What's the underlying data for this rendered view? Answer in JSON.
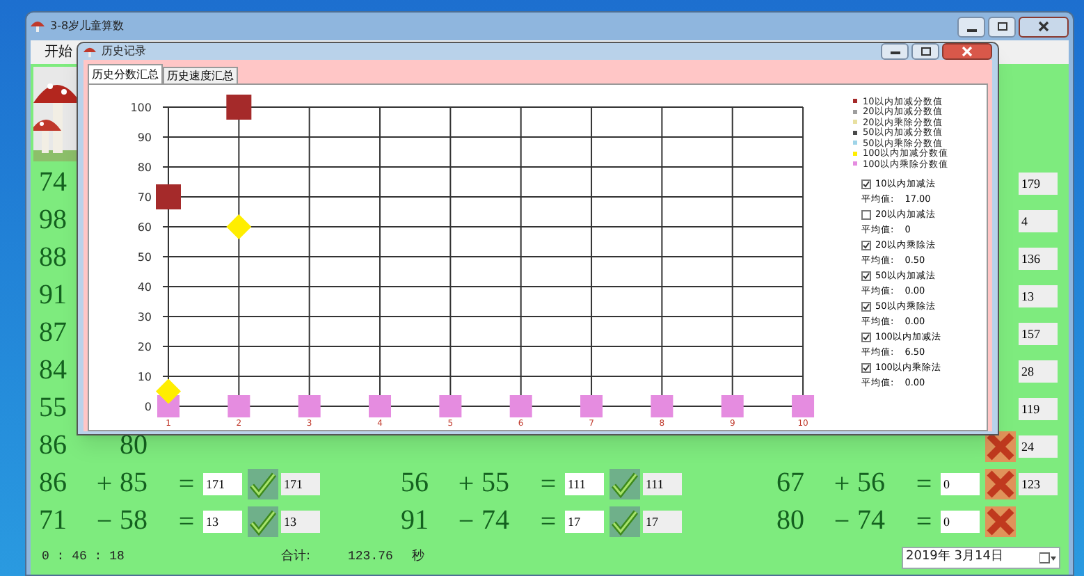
{
  "main_window": {
    "title": "3-8岁儿童算数"
  },
  "menu": [
    {
      "label": "开始"
    }
  ],
  "rows": [
    {
      "left": {
        "a": "74"
      },
      "right": {
        "correct_answer": "179"
      }
    },
    {
      "left": {
        "a": "98"
      },
      "right": {
        "correct_answer": "4"
      }
    },
    {
      "left": {
        "a": "88"
      },
      "right": {
        "correct_answer": "136"
      }
    },
    {
      "left": {
        "a": "91"
      },
      "right": {
        "correct_answer": "13"
      }
    },
    {
      "left": {
        "a": "87"
      },
      "right": {
        "correct_answer": "157"
      }
    },
    {
      "left": {
        "a": "84"
      },
      "right": {
        "correct_answer": "28"
      }
    },
    {
      "left": {
        "a": "55"
      },
      "right": {
        "correct_answer": "119"
      }
    },
    {
      "left": {
        "a": "86",
        "b": "80"
      },
      "right": {
        "correct": false,
        "correct_answer": "24"
      }
    },
    {
      "left": {
        "a": "86",
        "op": "+",
        "b": "85",
        "eq": "=",
        "answer": "171",
        "correct": true,
        "correct_answer": "171"
      },
      "middle": {
        "a": "56",
        "op": "+",
        "b": "55",
        "eq": "=",
        "answer": "111",
        "correct": true,
        "correct_answer": "111"
      },
      "right": {
        "a": "67",
        "op": "+",
        "b": "56",
        "eq": "=",
        "answer": "0",
        "correct": false,
        "correct_answer": "123"
      }
    },
    {
      "left": {
        "a": "71",
        "op": "−",
        "b": "58",
        "eq": "=",
        "answer": "13",
        "correct": true,
        "correct_answer": "13"
      },
      "middle": {
        "a": "91",
        "op": "−",
        "b": "74",
        "eq": "=",
        "answer": "17",
        "correct": true,
        "correct_answer": "17"
      },
      "right": {
        "a": "80",
        "op": "−",
        "b": "74",
        "eq": "=",
        "answer": "0",
        "correct": false
      }
    }
  ],
  "status_bar": {
    "time": "0 : 46 : 18",
    "total_label": "合计:",
    "total": "123.76",
    "unit": "秒",
    "date": "2019年 3月14日"
  },
  "dialog": {
    "title": "历史记录",
    "tabs": [
      {
        "label": "历史分数汇总",
        "selected": true
      },
      {
        "label": "历史速度汇总",
        "selected": false
      }
    ],
    "chart_data": {
      "type": "scatter",
      "grid": true,
      "categories": [
        "1",
        "2",
        "3",
        "4",
        "5",
        "6",
        "7",
        "8",
        "9",
        "10"
      ],
      "ylim": [
        0,
        100
      ],
      "yticks": [
        0,
        10,
        20,
        30,
        40,
        50,
        60,
        70,
        80,
        90,
        100
      ],
      "series": [
        {
          "name": "10以内加减分数值",
          "color": "#a52a2a",
          "marker": "square",
          "values": [
            70,
            100,
            null,
            null,
            null,
            null,
            null,
            null,
            null,
            null
          ]
        },
        {
          "name": "20以内加减分数值",
          "color": "#9e9e9e",
          "values": [
            null,
            null,
            null,
            null,
            null,
            null,
            null,
            null,
            null,
            null
          ]
        },
        {
          "name": "20以内乘除分数值",
          "color": "#e8e0a0",
          "values": [
            null,
            null,
            null,
            null,
            null,
            null,
            null,
            null,
            null,
            null
          ]
        },
        {
          "name": "50以内加减分数值",
          "color": "#4a4a4a",
          "values": [
            null,
            null,
            null,
            null,
            null,
            null,
            null,
            null,
            null,
            null
          ]
        },
        {
          "name": "50以内乘除分数值",
          "color": "#9fd4e8",
          "values": [
            null,
            null,
            null,
            null,
            null,
            null,
            null,
            null,
            null,
            null
          ]
        },
        {
          "name": "100以内加减分数值",
          "color": "#ffee00",
          "marker": "diamond",
          "values": [
            5,
            60,
            null,
            null,
            null,
            null,
            null,
            null,
            null,
            null
          ]
        },
        {
          "name": "100以内乘除分数值",
          "color": "#e58ce0",
          "marker": "square",
          "values": [
            0,
            0,
            0,
            0,
            0,
            0,
            0,
            0,
            0,
            0
          ]
        }
      ]
    },
    "options": [
      {
        "label": "10以内加减法",
        "checked": true,
        "average_label": "平均值:",
        "average": "17.00"
      },
      {
        "label": "20以内加减法",
        "checked": false,
        "average_label": "平均值:",
        "average": "0"
      },
      {
        "label": "20以内乘除法",
        "checked": true,
        "average_label": "平均值:",
        "average": "0.50"
      },
      {
        "label": "50以内加减法",
        "checked": true,
        "average_label": "平均值:",
        "average": "0.00"
      },
      {
        "label": "50以内乘除法",
        "checked": true,
        "average_label": "平均值:",
        "average": "0.00"
      },
      {
        "label": "100以内加减法",
        "checked": true,
        "average_label": "平均值:",
        "average": "6.50"
      },
      {
        "label": "100以内乘除法",
        "checked": true,
        "average_label": "平均值:",
        "average": "0.00"
      }
    ]
  }
}
